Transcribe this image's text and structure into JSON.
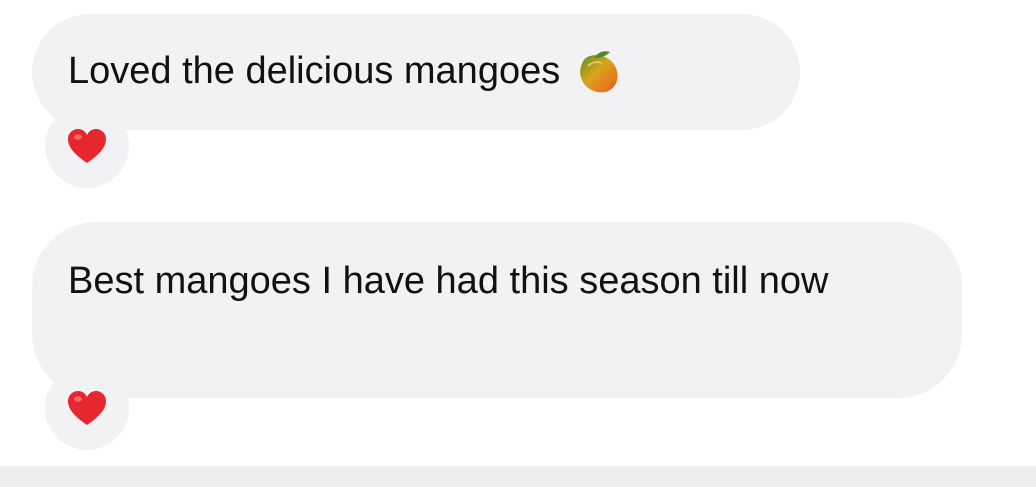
{
  "messages": [
    {
      "text": "Loved the delicious mangoes",
      "inline_icon": "mango-icon",
      "reaction": "heart-icon"
    },
    {
      "text": "Best mangoes I have had this season till now",
      "reaction": "heart-icon"
    }
  ],
  "colors": {
    "bubble_background": "#f2f2f4",
    "text": "#111111",
    "heart": "#e8262d"
  }
}
